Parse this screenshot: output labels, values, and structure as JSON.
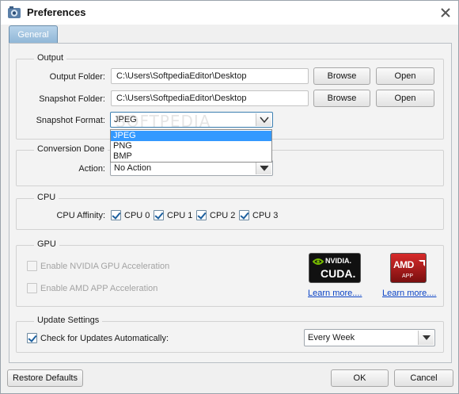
{
  "window": {
    "title": "Preferences"
  },
  "tabs": [
    {
      "label": "General"
    }
  ],
  "output": {
    "group_title": "Output",
    "output_folder_label": "Output Folder:",
    "output_folder_value": "C:\\Users\\SoftpediaEditor\\Desktop",
    "snapshot_folder_label": "Snapshot Folder:",
    "snapshot_folder_value": "C:\\Users\\SoftpediaEditor\\Desktop",
    "browse_label": "Browse",
    "open_label": "Open",
    "snapshot_format_label": "Snapshot Format:",
    "snapshot_format_value": "JPEG",
    "snapshot_format_options": [
      "JPEG",
      "PNG",
      "BMP"
    ]
  },
  "watermark": "SOFTPEDIA",
  "conversion_done": {
    "group_title": "Conversion Done",
    "action_label": "Action:",
    "action_value": "No Action"
  },
  "cpu": {
    "group_title": "CPU",
    "affinity_label": "CPU Affinity:",
    "cores": [
      {
        "label": "CPU 0",
        "checked": true
      },
      {
        "label": "CPU 1",
        "checked": true
      },
      {
        "label": "CPU 2",
        "checked": true
      },
      {
        "label": "CPU 3",
        "checked": true
      }
    ]
  },
  "gpu": {
    "group_title": "GPU",
    "nvidia_label": "Enable NVIDIA GPU Acceleration",
    "amd_label": "Enable AMD APP Acceleration",
    "nvidia_logo_top": "NVIDIA.",
    "nvidia_logo_bottom": "CUDA.",
    "amd_logo_top": "AMD",
    "amd_logo_bottom": "APP",
    "learn_more": "Learn more...."
  },
  "update": {
    "group_title": "Update Settings",
    "check_label": "Check for Updates Automatically:",
    "checked": true,
    "frequency_value": "Every Week"
  },
  "footer": {
    "restore_label": "Restore Defaults",
    "ok_label": "OK",
    "cancel_label": "Cancel"
  },
  "colors": {
    "tab_active": "#8fb6d6",
    "link": "#0b43c6",
    "selection": "#3399ff",
    "nvidia_green": "#76b900",
    "amd_red": "#c8102e"
  }
}
